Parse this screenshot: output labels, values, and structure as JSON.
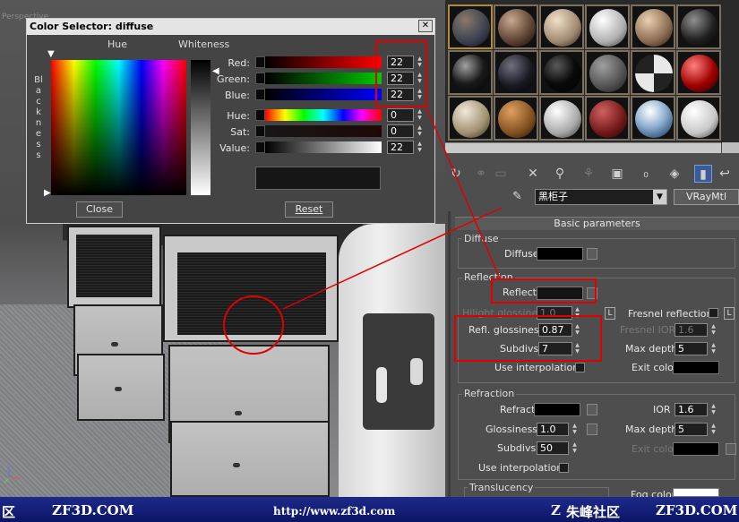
{
  "viewport": {
    "label": "Perspective"
  },
  "color_selector": {
    "title": "Color Selector: diffuse",
    "close_glyph": "✕",
    "hue_heading": "Hue",
    "whiteness_heading": "Whiteness",
    "blackness_label": "Blackness",
    "channels": [
      {
        "label": "Red:",
        "value": "22"
      },
      {
        "label": "Green:",
        "value": "22"
      },
      {
        "label": "Blue:",
        "value": "22"
      },
      {
        "label": "Hue:",
        "value": "0"
      },
      {
        "label": "Sat:",
        "value": "0"
      },
      {
        "label": "Value:",
        "value": "22"
      }
    ],
    "close_button": "Close",
    "reset_button": "Reset"
  },
  "material_editor": {
    "material_name": "黑柜子",
    "material_type": "VRayMtl",
    "rollout_title": "Basic parameters",
    "diffuse": {
      "group": "Diffuse",
      "label": "Diffuse"
    },
    "reflection": {
      "group": "Reflection",
      "reflect_label": "Reflect",
      "hilight_label": "Hilight glossiness",
      "hilight_value": "1.0",
      "l_button": "L",
      "fresnel_label": "Fresnel reflections",
      "refl_gloss_label": "Refl. glossiness",
      "refl_gloss_value": "0.87",
      "fresnel_ior_label": "Fresnel IOR",
      "fresnel_ior_value": "1.6",
      "subdivs_label": "Subdivs",
      "subdivs_value": "7",
      "max_depth_label": "Max depth",
      "max_depth_value": "5",
      "use_interp_label": "Use interpolation",
      "exit_color_label": "Exit color"
    },
    "refraction": {
      "group": "Refraction",
      "refract_label": "Refract",
      "ior_label": "IOR",
      "ior_value": "1.6",
      "glossiness_label": "Glossiness",
      "glossiness_value": "1.0",
      "max_depth_label": "Max depth",
      "max_depth_value": "5",
      "subdivs_label": "Subdivs",
      "subdivs_value": "50",
      "exit_color_label": "Exit color",
      "use_interp_label": "Use interpolation"
    },
    "translucency": {
      "group": "Translucency",
      "fog_color_label": "Fog color"
    }
  },
  "banner": {
    "left_char": "区",
    "brand1": "ZF3D.COM",
    "url": "http://www.zf3d.com",
    "cn_brand": "朱峰社区",
    "brand2": "ZF3D.COM"
  }
}
